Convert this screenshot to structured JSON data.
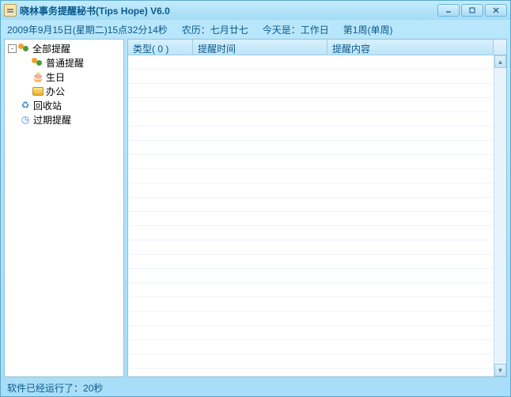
{
  "title": "晓林事务提醒秘书(Tips Hope) V6.0",
  "info": {
    "datetime": "2009年9月15日(星期二)15点32分14秒",
    "lunar": "农历：七月廿七",
    "today": "今天是：工作日",
    "week": "第1周(单周)"
  },
  "tree": {
    "root": {
      "label": "全部提醒"
    },
    "children": [
      {
        "label": "普通提醒"
      },
      {
        "label": "生日"
      },
      {
        "label": "办公"
      }
    ],
    "recycle": "回收站",
    "expired": "过期提醒"
  },
  "table": {
    "columns": {
      "type": "类型( 0 )",
      "time": "提醒时间",
      "content": "提醒内容"
    },
    "rows": []
  },
  "status": {
    "label": "软件已经运行了：",
    "value": "20秒"
  }
}
